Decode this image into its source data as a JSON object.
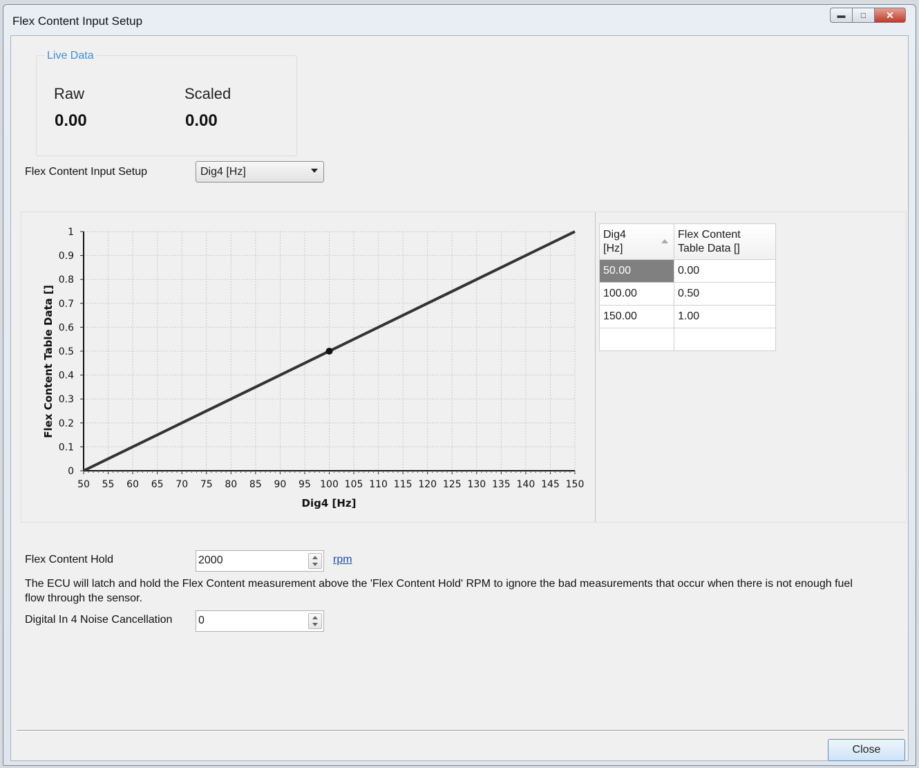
{
  "window": {
    "title": "Flex Content Input Setup",
    "buttons": [
      "minimize",
      "restore",
      "close"
    ]
  },
  "live_data": {
    "legend": "Live Data",
    "raw_label": "Raw",
    "raw_value": "0.00",
    "scaled_label": "Scaled",
    "scaled_value": "0.00"
  },
  "input_setup": {
    "label": "Flex Content Input Setup",
    "selected": "Dig4 [Hz]"
  },
  "chart_data": {
    "type": "line",
    "xlabel": "Dig4 [Hz]",
    "ylabel": "Flex Content Table Data []",
    "xlim": [
      50,
      150
    ],
    "ylim": [
      0,
      1
    ],
    "x_ticks": [
      "50",
      "55",
      "60",
      "65",
      "70",
      "75",
      "80",
      "85",
      "90",
      "95",
      "100",
      "105",
      "110",
      "115",
      "120",
      "125",
      "130",
      "135",
      "140",
      "145",
      "150"
    ],
    "y_ticks": [
      "0",
      "0.1",
      "0.2",
      "0.3",
      "0.4",
      "0.5",
      "0.6",
      "0.7",
      "0.8",
      "0.9",
      "1"
    ],
    "grid": true,
    "x": [
      50,
      100,
      150
    ],
    "y": [
      0,
      0.5,
      1
    ],
    "highlighted_point": [
      100,
      0.5
    ]
  },
  "table": {
    "columns": [
      "Dig4 [Hz]",
      "Flex Content Table Data []"
    ],
    "rows": [
      [
        "50.00",
        "0.00"
      ],
      [
        "100.00",
        "0.50"
      ],
      [
        "150.00",
        "1.00"
      ],
      [
        "",
        ""
      ]
    ]
  },
  "hold": {
    "label": "Flex Content Hold",
    "value": "2000",
    "unit": "rpm"
  },
  "description": "The ECU will latch and hold the Flex Content measurement above the 'Flex Content Hold' RPM to ignore the bad measurements that occur when there is not enough fuel flow through the sensor.",
  "noise": {
    "label": "Digital In 4 Noise Cancellation",
    "value": "0"
  },
  "footer": {
    "close_label": "Close"
  },
  "icons": {
    "minimize": "minimize-icon",
    "restore": "restore-icon",
    "close": "close-icon",
    "dropdown": "chevron-down-icon",
    "spin": "spin-arrows-icon",
    "sort": "sort-ascending-icon"
  }
}
